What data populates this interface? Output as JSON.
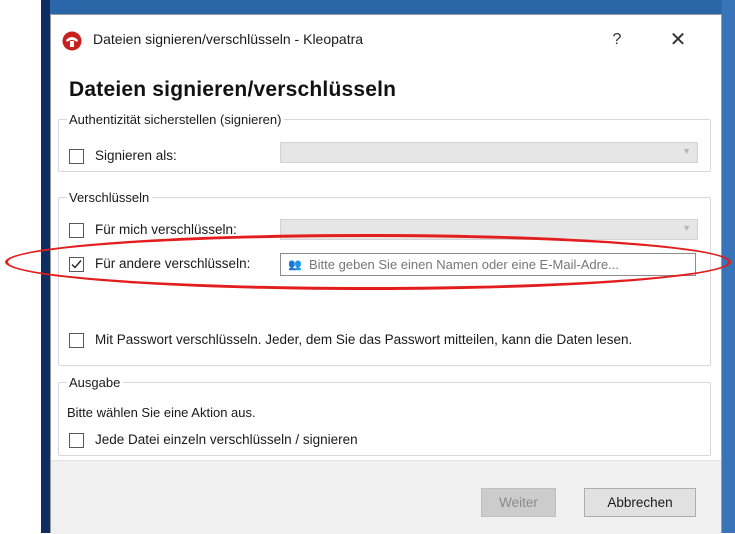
{
  "window": {
    "title": "Dateien signieren/verschlüsseln - Kleopatra",
    "help_label": "?",
    "close_label": "✕"
  },
  "dialog": {
    "heading": "Dateien signieren/verschlüsseln"
  },
  "sign_group": {
    "label": "Authentizität sicherstellen (signieren)",
    "sign_as": {
      "label": "Signieren als:",
      "checked": false,
      "value": ""
    }
  },
  "encrypt_group": {
    "label": "Verschlüsseln",
    "for_me": {
      "label": "Für mich verschlüsseln:",
      "checked": false,
      "value": ""
    },
    "for_others": {
      "label": "Für andere verschlüsseln:",
      "checked": true,
      "placeholder": "Bitte geben Sie einen Namen oder eine E-Mail-Adre..."
    },
    "password": {
      "label": "Mit Passwort verschlüsseln. Jeder, dem Sie das Passwort mitteilen, kann die Daten lesen.",
      "checked": false
    }
  },
  "output_group": {
    "label": "Ausgabe",
    "hint": "Bitte wählen Sie eine Aktion aus.",
    "each_file": {
      "label": "Jede Datei einzeln verschlüsseln / signieren",
      "checked": false
    }
  },
  "buttons": {
    "next_label": "Weiter",
    "cancel_label": "Abbrechen"
  },
  "colors": {
    "highlight": "#e31d1d",
    "disabled_field": "#e6e6e6",
    "footer": "#f0f0f0",
    "app_icon": "#c8201e"
  },
  "icons": {
    "app": "kleopatra-icon",
    "recipients": "people-icon",
    "checkmark": "checkmark-icon"
  }
}
